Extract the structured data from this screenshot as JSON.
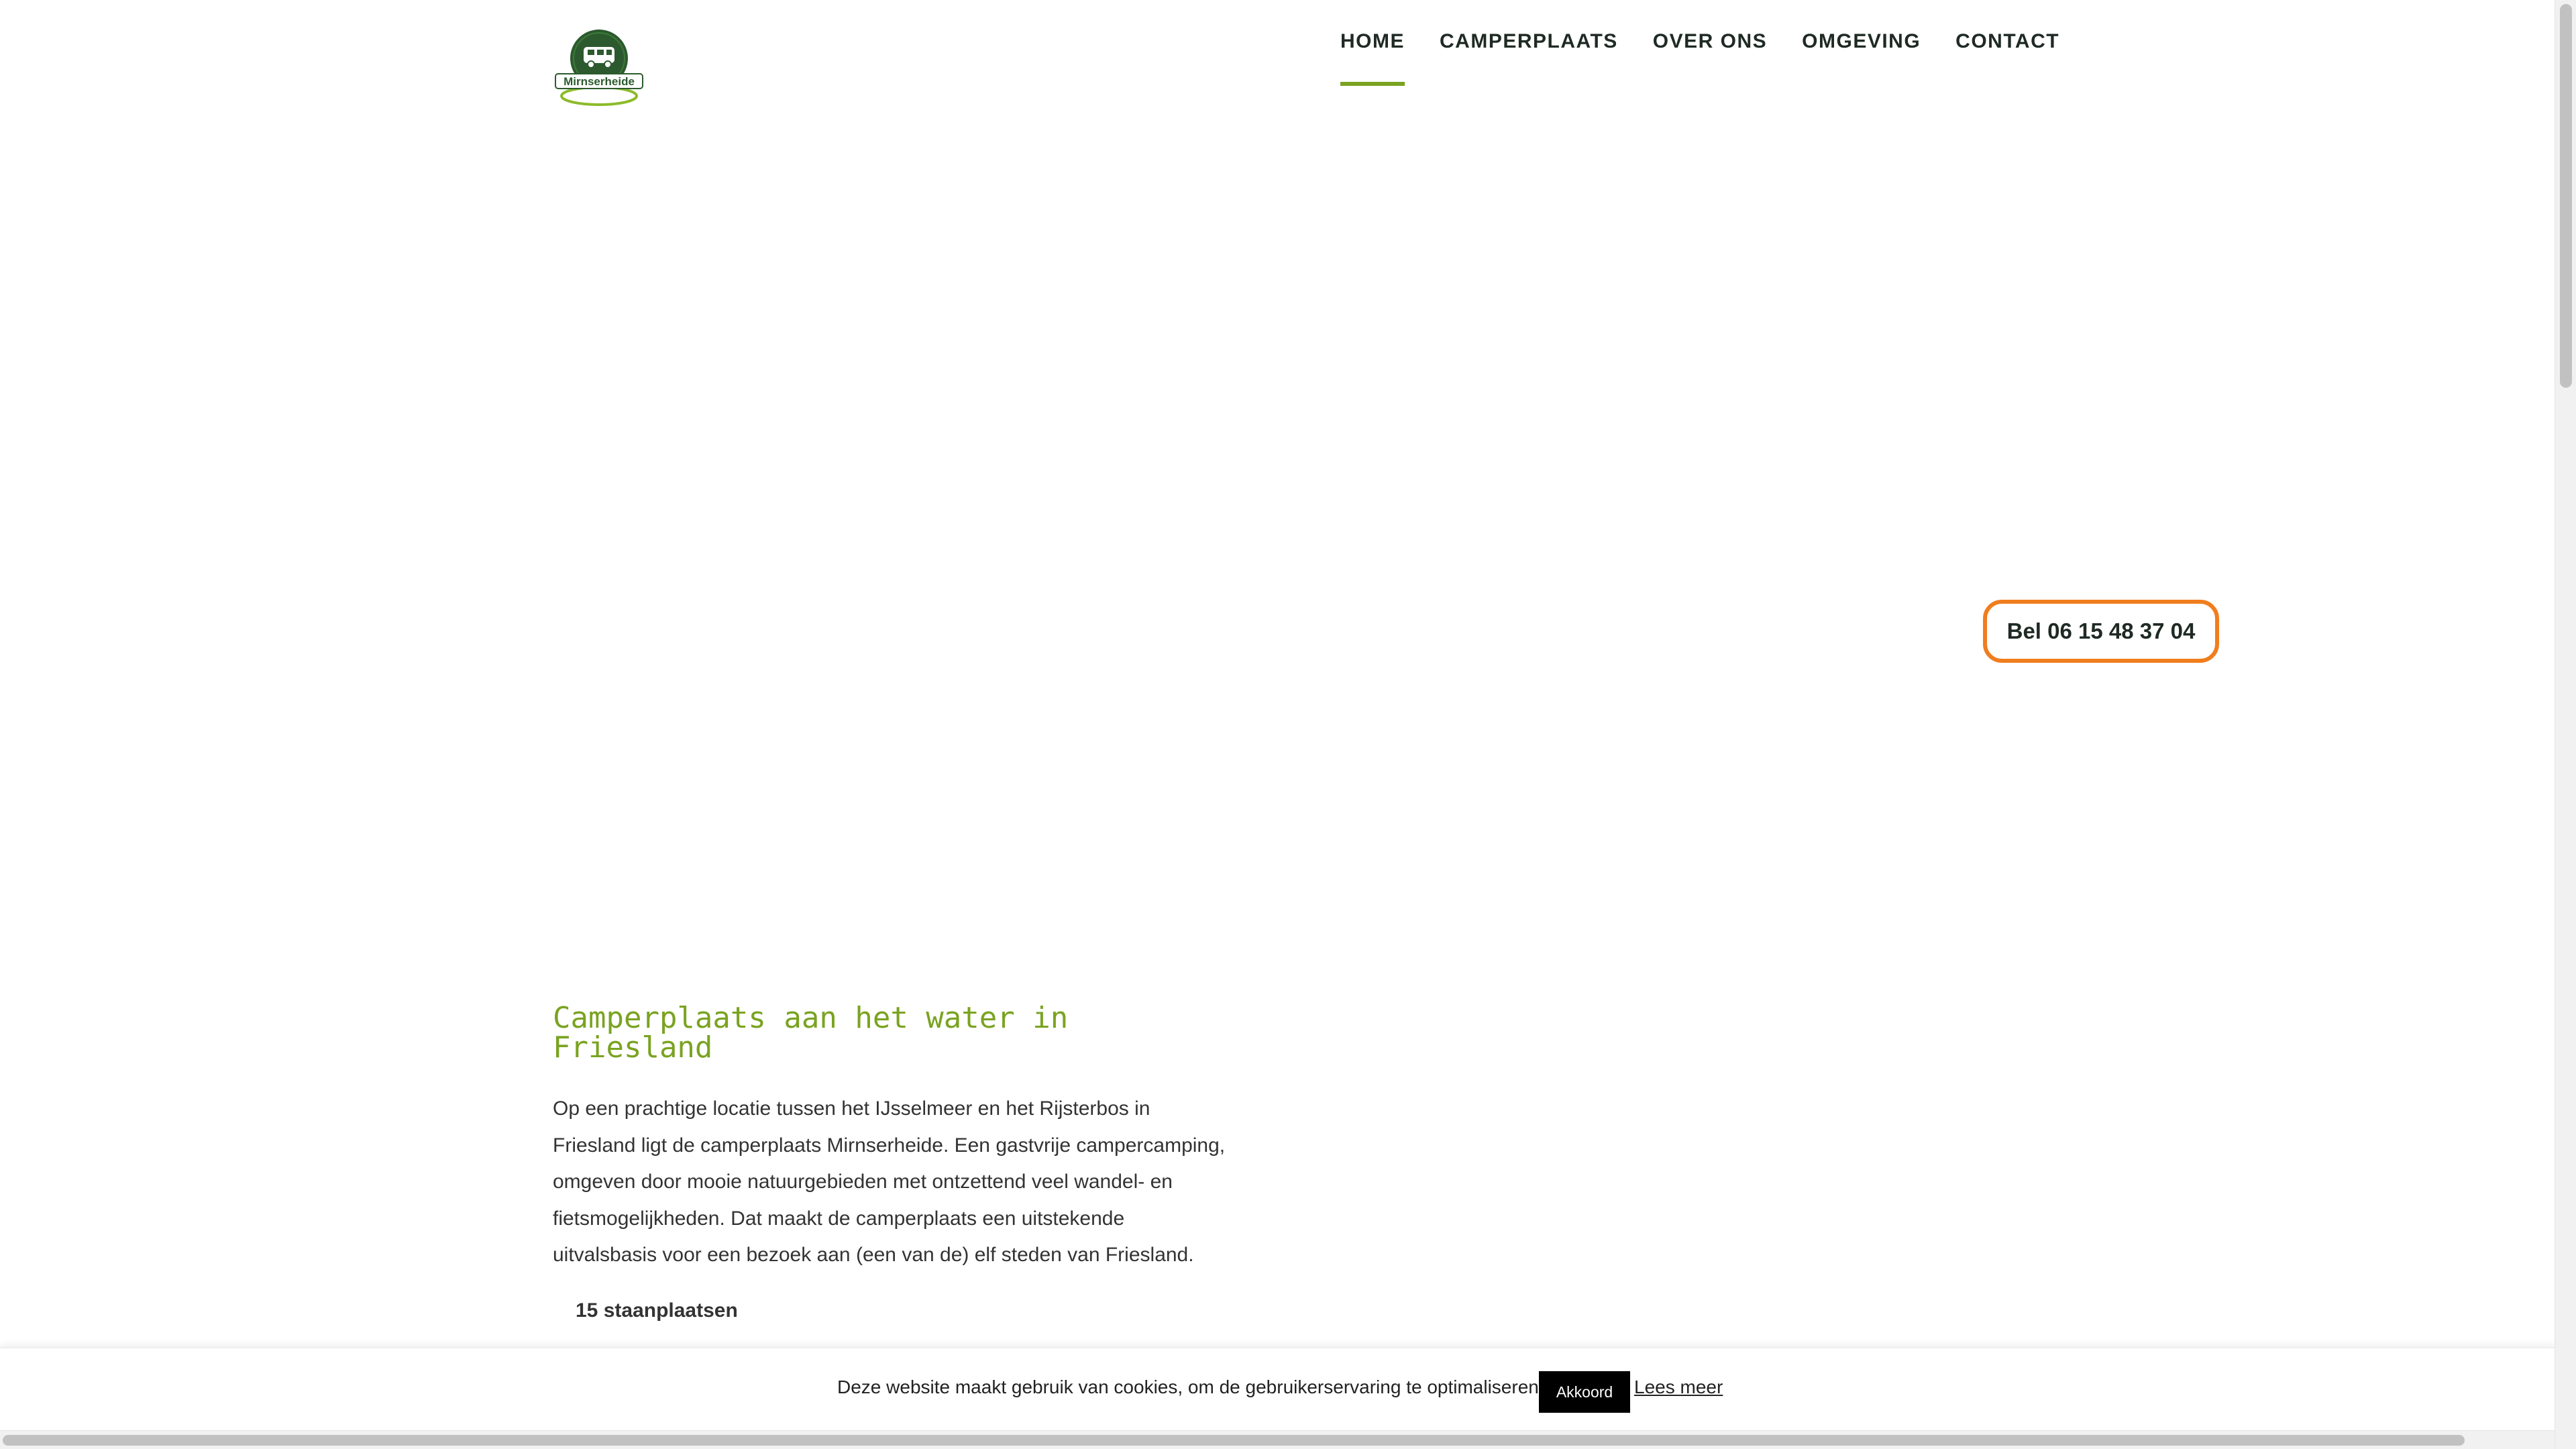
{
  "header": {
    "logo_text": "Mirnserheide",
    "nav": [
      {
        "label": "HOME",
        "active": true
      },
      {
        "label": "CAMPERPLAATS",
        "active": false
      },
      {
        "label": "OVER ONS",
        "active": false
      },
      {
        "label": "OMGEVING",
        "active": false
      },
      {
        "label": "CONTACT",
        "active": false
      }
    ]
  },
  "call_button": {
    "label": "Bel 06 15 48 37 04"
  },
  "main": {
    "heading": "Camperplaats aan het water in Friesland",
    "intro": "Op een prachtige locatie tussen het IJsselmeer en het Rijsterbos in Friesland ligt de camperplaats Mirnserheide. Een gastvrije campercamping, omgeven door mooie natuurgebieden met ontzettend veel wandel- en fietsmogelijkheden. Dat maakt de camperplaats een uitstekende uitvalsbasis voor een bezoek aan (een van de) elf steden van Friesland.",
    "features": [
      "15 staanplaatsen"
    ]
  },
  "cookie_bar": {
    "text": "Deze website maakt gebruik van cookies, om de gebruikerservaring te optimaliseren.",
    "accept_label": "Akkoord",
    "more_label": "Lees meer"
  },
  "colors": {
    "accent_green": "#7aa321",
    "logo_green": "#2c5a2e",
    "call_orange": "#f07d1e",
    "nav_text": "#1f2a24"
  },
  "icons": {
    "logo": "camper-van-icon"
  }
}
